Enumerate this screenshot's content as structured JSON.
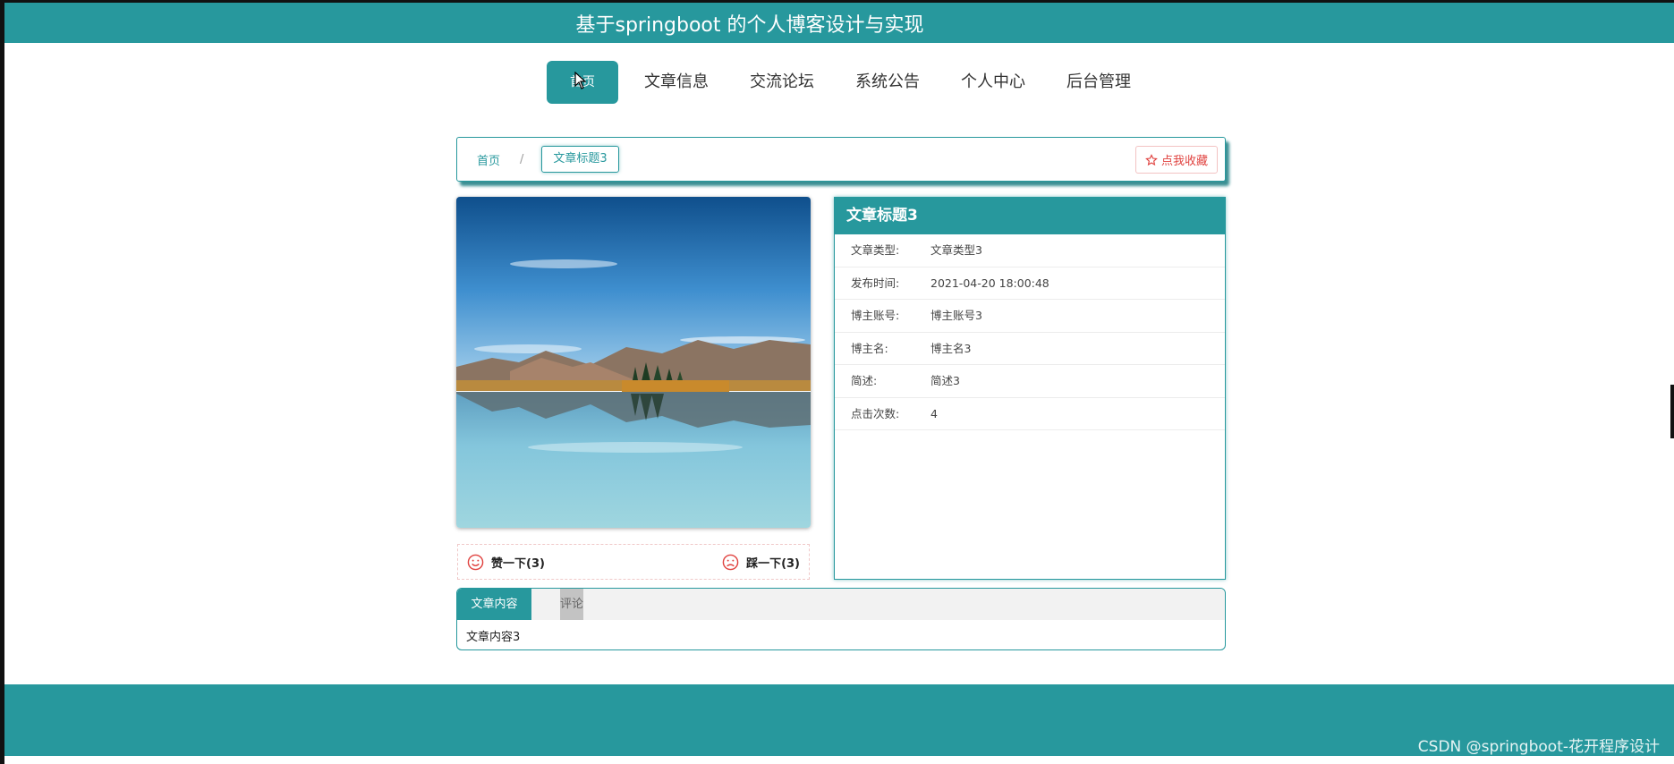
{
  "header": {
    "title": "基于springboot 的个人博客设计与实现"
  },
  "nav": {
    "items": [
      {
        "label": "首页",
        "active": true
      },
      {
        "label": "文章信息"
      },
      {
        "label": "交流论坛"
      },
      {
        "label": "系统公告"
      },
      {
        "label": "个人中心"
      },
      {
        "label": "后台管理"
      }
    ]
  },
  "breadcrumb": {
    "home": "首页",
    "separator": "/",
    "current": "文章标题3"
  },
  "favorite": {
    "label": "点我收藏",
    "icon": "star-outline-icon"
  },
  "image": {
    "alt": "lake-mountain-landscape"
  },
  "votes": {
    "like": {
      "label": "赞一下(3)",
      "icon": "smile-face-icon"
    },
    "dislike": {
      "label": "踩一下(3)",
      "icon": "frown-face-icon"
    }
  },
  "info": {
    "title": "文章标题3",
    "rows": [
      {
        "key": "文章类型:",
        "value": "文章类型3"
      },
      {
        "key": "发布时间:",
        "value": "2021-04-20 18:00:48"
      },
      {
        "key": "博主账号:",
        "value": "博主账号3"
      },
      {
        "key": "博主名:",
        "value": "博主名3"
      },
      {
        "key": "简述:",
        "value": "简述3"
      },
      {
        "key": "点击次数:",
        "value": "4"
      }
    ]
  },
  "tabs": {
    "items": [
      {
        "label": "文章内容",
        "active": true
      },
      {
        "label": "评论"
      }
    ],
    "content": "文章内容3"
  },
  "watermark": "CSDN @springboot-花开程序设计",
  "colors": {
    "primary": "#27989d",
    "danger": "#e0423f"
  }
}
